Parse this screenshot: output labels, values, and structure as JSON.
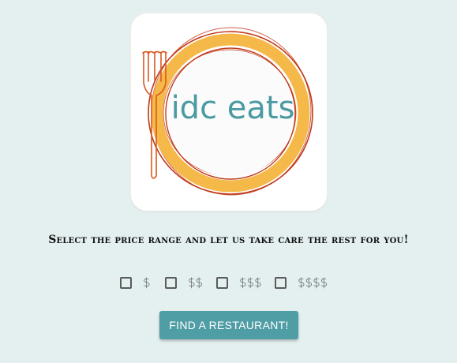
{
  "logo": {
    "text": "idc eats",
    "colors": {
      "plate_rim": "#f5b94a",
      "plate_outline": "#c0391b",
      "fork": "#d8591f",
      "text": "#4a9aa2"
    }
  },
  "headline": "Select the price range and let us take care the rest for you!",
  "price_options": [
    {
      "label": "$",
      "checked": false
    },
    {
      "label": "$$",
      "checked": false
    },
    {
      "label": "$$$",
      "checked": false
    },
    {
      "label": "$$$$",
      "checked": false
    }
  ],
  "find_button": {
    "label": "FIND A RESTAURANT!"
  },
  "colors": {
    "background": "#e4f0f0",
    "accent": "#4f9da5"
  }
}
